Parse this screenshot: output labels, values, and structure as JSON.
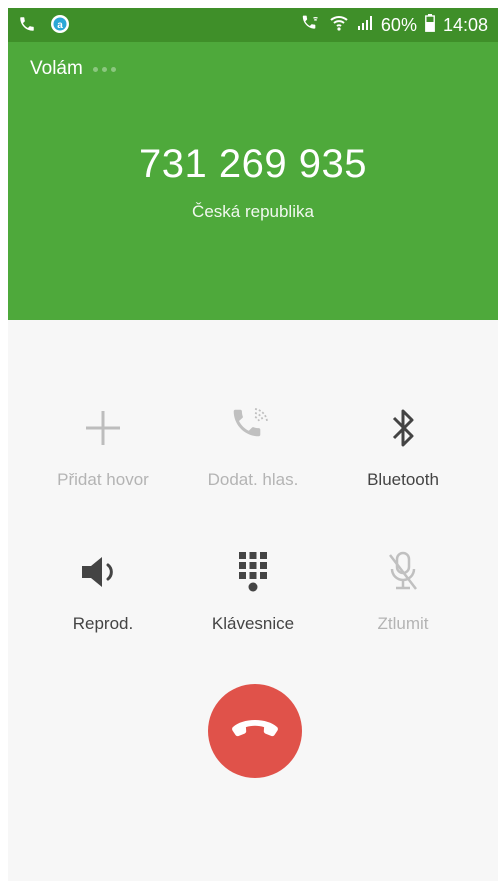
{
  "status_bar": {
    "battery_text": "60%",
    "time": "14:08",
    "left_icons": [
      "phone-call-icon",
      "app-a-icon"
    ],
    "right_icons": [
      "wifi-calling-icon",
      "wifi-icon",
      "signal-icon",
      "battery-icon"
    ]
  },
  "call": {
    "status_label": "Volám",
    "number": "731 269 935",
    "country": "Česká republika"
  },
  "controls": [
    {
      "label": "Přidat hovor",
      "icon": "add-call-icon",
      "enabled": false
    },
    {
      "label": "Dodat. hlas.",
      "icon": "extra-volume-icon",
      "enabled": false
    },
    {
      "label": "Bluetooth",
      "icon": "bluetooth-icon",
      "enabled": true
    },
    {
      "label": "Reprod.",
      "icon": "speaker-icon",
      "enabled": true
    },
    {
      "label": "Klávesnice",
      "icon": "keypad-icon",
      "enabled": true
    },
    {
      "label": "Ztlumit",
      "icon": "mute-mic-icon",
      "enabled": false
    }
  ],
  "colors": {
    "status_bar": "#3f8f29",
    "header": "#4ea93b",
    "end_call": "#e0524a",
    "background": "#f7f7f7"
  },
  "end_call_icon": "end-call-icon"
}
